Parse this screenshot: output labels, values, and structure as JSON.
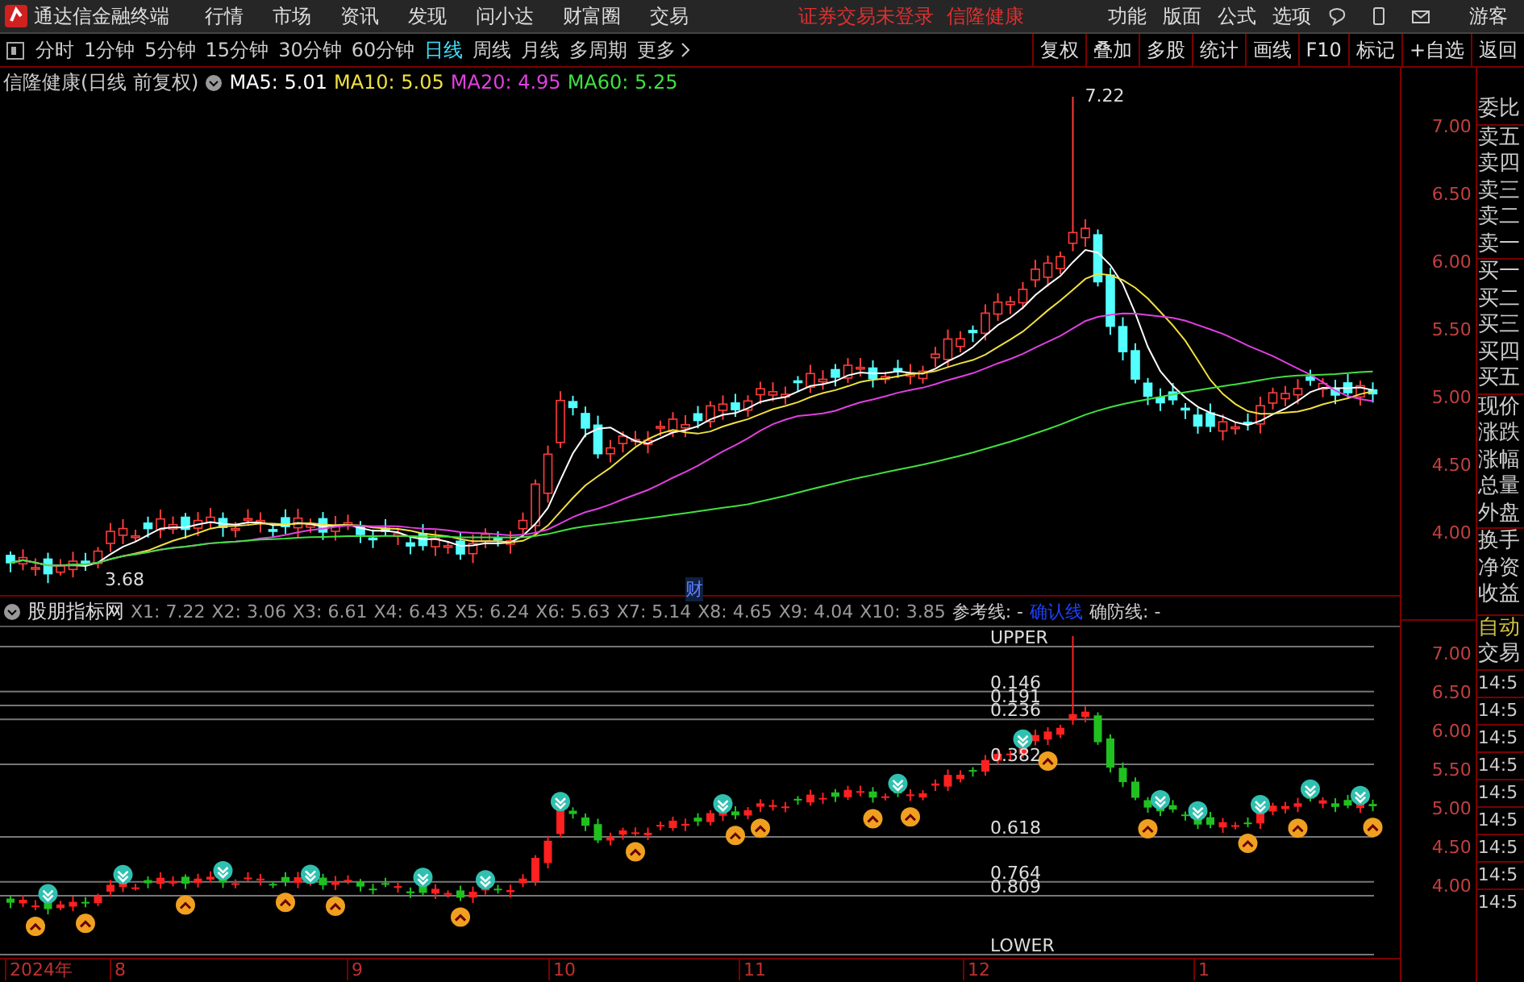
{
  "app": {
    "title": "通达信金融终端",
    "menu": [
      "行情",
      "市场",
      "资讯",
      "发现",
      "问小达",
      "财富圈",
      "交易"
    ],
    "notice": "证券交易未登录",
    "stock_name": "信隆健康",
    "right_menu": [
      "功能",
      "版面",
      "公式",
      "选项"
    ],
    "user": "游客"
  },
  "periods": [
    {
      "label": "分时",
      "selected": false
    },
    {
      "label": "1分钟",
      "selected": false
    },
    {
      "label": "5分钟",
      "selected": false
    },
    {
      "label": "15分钟",
      "selected": false
    },
    {
      "label": "30分钟",
      "selected": false
    },
    {
      "label": "60分钟",
      "selected": false
    },
    {
      "label": "日线",
      "selected": true
    },
    {
      "label": "周线",
      "selected": false
    },
    {
      "label": "月线",
      "selected": false
    },
    {
      "label": "多周期",
      "selected": false
    }
  ],
  "more": "更多",
  "tools": [
    "复权",
    "叠加",
    "多股",
    "统计",
    "画线",
    "F10",
    "标记",
    "+自选",
    "返回"
  ],
  "chart": {
    "title": "信隆健康(日线 前复权)",
    "ma": [
      {
        "label": "MA5: 5.01",
        "color": "#ffffff"
      },
      {
        "label": "MA10: 5.05",
        "color": "#f0e040"
      },
      {
        "label": "MA20: 4.95",
        "color": "#e040e0"
      },
      {
        "label": "MA60: 5.25",
        "color": "#40e040"
      }
    ],
    "yticks": [
      "7.00",
      "6.50",
      "6.00",
      "5.50",
      "5.00",
      "4.50",
      "4.00"
    ],
    "high_label": "7.22",
    "low_label": "3.68",
    "event_tag": "财"
  },
  "quote_panel": [
    "委比",
    "卖五",
    "卖四",
    "卖三",
    "卖二",
    "卖一",
    "买一",
    "买二",
    "买三",
    "买四",
    "买五",
    "现价",
    "涨跌",
    "涨幅",
    "总量",
    "外盘",
    "换手",
    "净资",
    "收益"
  ],
  "indicator": {
    "name": "股朋指标网",
    "values": [
      "X1: 7.22",
      "X2: 3.06",
      "X3: 6.61",
      "X4: 6.43",
      "X5: 6.24",
      "X6: 5.63",
      "X7: 5.14",
      "X8: 4.65",
      "X9: 4.04",
      "X10: 3.85"
    ],
    "ref_label": "参考线: -",
    "link": "确认线",
    "defense_label": "确防线: -",
    "yticks": [
      "7.00",
      "6.50",
      "6.00",
      "5.50",
      "5.00",
      "4.50",
      "4.00"
    ],
    "levels": [
      {
        "kind": "upper",
        "label": "UPPER"
      },
      {
        "kind": "ratio",
        "label": "0.146"
      },
      {
        "kind": "ratio",
        "label": "0.191"
      },
      {
        "kind": "ratio",
        "label": "0.236"
      },
      {
        "kind": "ratio",
        "label": "0.382"
      },
      {
        "kind": "ratio",
        "label": "0.618"
      },
      {
        "kind": "ratio",
        "label": "0.764"
      },
      {
        "kind": "ratio",
        "label": "0.809"
      },
      {
        "kind": "lower",
        "label": "LOWER"
      }
    ]
  },
  "trade_panel": {
    "mode": "自动",
    "title": "交易",
    "times": [
      "14:5",
      "14:5",
      "14:5",
      "14:5",
      "14:5",
      "14:5",
      "14:5",
      "14:5",
      "14:5"
    ]
  },
  "x_axis": [
    "2024年",
    "8",
    "9",
    "10",
    "11",
    "12",
    "1"
  ]
}
